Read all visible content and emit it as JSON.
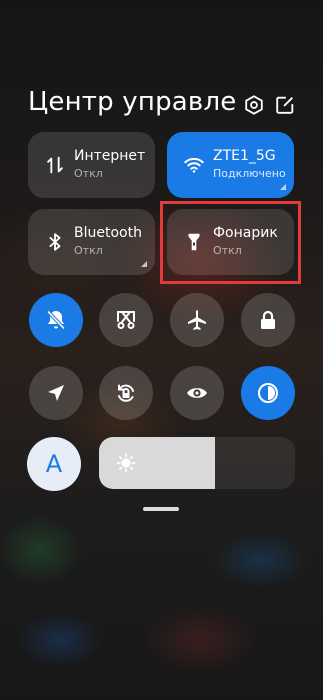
{
  "header": {
    "title": "Центр управле...",
    "icons": [
      "settings-hexagon-icon",
      "edit-icon"
    ]
  },
  "tiles": [
    {
      "name": "Интернет",
      "status": "Откл",
      "icon": "mobile-data-icon",
      "active": false
    },
    {
      "name": "ZTE1_5G",
      "status": "Подключено",
      "icon": "wifi-icon",
      "active": true
    },
    {
      "name": "Bluetooth",
      "status": "Откл",
      "icon": "bluetooth-icon",
      "active": false
    },
    {
      "name": "Фонарик",
      "status": "Откл",
      "icon": "flashlight-icon",
      "active": false,
      "highlighted": true
    }
  ],
  "toggles_row1": [
    {
      "icon": "mute-bell-icon",
      "active": true
    },
    {
      "icon": "screenshot-icon",
      "active": false
    },
    {
      "icon": "airplane-icon",
      "active": false
    },
    {
      "icon": "lock-icon",
      "active": false
    }
  ],
  "toggles_row2": [
    {
      "icon": "location-icon",
      "active": false
    },
    {
      "icon": "rotation-lock-icon",
      "active": false
    },
    {
      "icon": "eye-reading-mode-icon",
      "active": false
    },
    {
      "icon": "dark-mode-icon",
      "active": true
    }
  ],
  "brightness": {
    "auto_label": "A",
    "level_percent": 59,
    "icon": "sun-icon"
  },
  "colors": {
    "accent": "#1a7ae6",
    "highlight_box": "#e23b3b"
  }
}
